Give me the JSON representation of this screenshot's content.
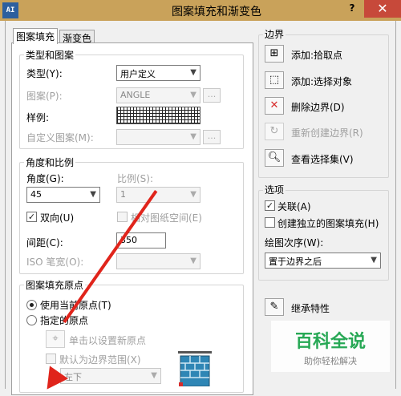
{
  "window": {
    "title": "图案填充和渐变色",
    "app_icon": "AI",
    "help": "?",
    "close": "✕"
  },
  "tabs": [
    {
      "label": "图案填充"
    },
    {
      "label": "渐变色"
    }
  ],
  "type_pattern": {
    "group_title": "类型和图案",
    "type_label": "类型(Y):",
    "type_value": "用户定义",
    "pattern_label": "图案(P):",
    "pattern_value": "ANGLE",
    "swatch_label": "样例:",
    "custom_label": "自定义图案(M):",
    "ellipsis": "..."
  },
  "angle_scale": {
    "group_title": "角度和比例",
    "angle_label": "角度(G):",
    "angle_value": "45",
    "scale_label": "比例(S):",
    "scale_value": "1",
    "double_label": "双向(U)",
    "double_checked": "✓",
    "relative_label": "相对图纸空间(E)",
    "spacing_label": "间距(C):",
    "spacing_value": "350",
    "iso_label": "ISO 笔宽(O):"
  },
  "origin": {
    "group_title": "图案填充原点",
    "use_current_label": "使用当前原点(T)",
    "specified_label": "指定的原点",
    "click_set_label": "单击以设置新原点",
    "default_extent_label": "默认为边界范围(X)",
    "position_value": "左下"
  },
  "boundaries": {
    "group_title": "边界",
    "add_pick_label": "添加:拾取点",
    "add_select_label": "添加:选择对象",
    "remove_label": "删除边界(D)",
    "recreate_label": "重新创建边界(R)",
    "view_label": "查看选择集(V)"
  },
  "options": {
    "group_title": "选项",
    "associative_label": "关联(A)",
    "associative_checked": "✓",
    "separate_label": "创建独立的图案填充(H)",
    "draw_order_label": "绘图次序(W):",
    "draw_order_value": "置于边界之后"
  },
  "inherit_label": "继承特性",
  "watermark": {
    "logo": "百科全说",
    "tagline": "助你轻松解决"
  },
  "colors": {
    "accent_arrow": "#e0241b",
    "titlebar": "#c9a25a",
    "close": "#c7493a",
    "watermark_green": "#18a34a"
  }
}
